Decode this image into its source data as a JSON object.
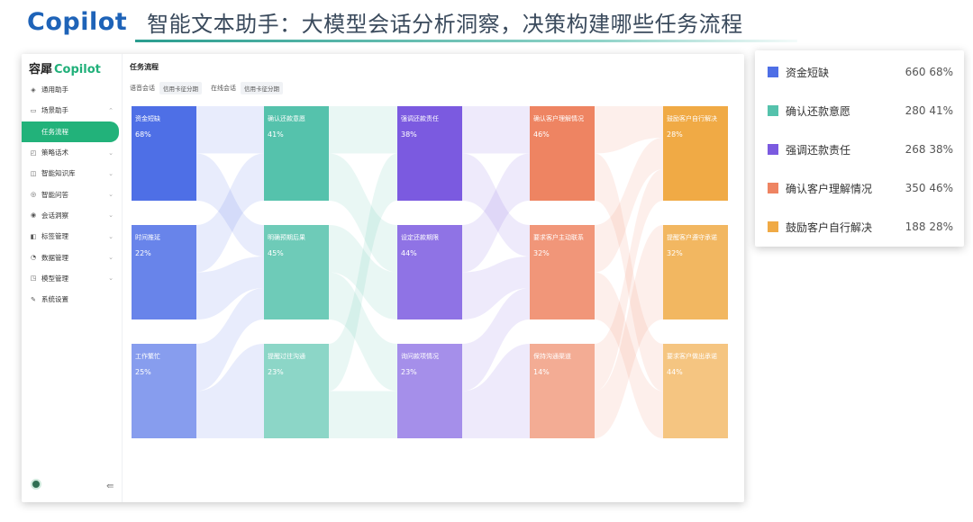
{
  "slide": {
    "brand": "Copilot",
    "headline": "智能文本助手：大模型会话分析洞察，决策构建哪些任务流程"
  },
  "app": {
    "logo_cn": "容犀",
    "logo_en": "Copilot",
    "page_title": "任务流程",
    "filters": {
      "voice_label": "语音会话",
      "voice_tag": "信用卡征分期",
      "online_label": "在线会话",
      "online_tag": "信用卡征分期"
    },
    "sidebar": {
      "items": [
        {
          "label": "通用助手",
          "icon": "layers-icon",
          "icon_char": "◈",
          "expandable": false
        },
        {
          "label": "场景助手",
          "icon": "monitor-icon",
          "icon_char": "▭",
          "expandable": true,
          "expanded": true
        },
        {
          "label": "任务流程",
          "icon": "",
          "icon_char": "",
          "sub": true,
          "active": true
        },
        {
          "label": "策略话术",
          "icon": "chat-icon",
          "icon_char": "◰",
          "expandable": true
        },
        {
          "label": "智能知识库",
          "icon": "book-icon",
          "icon_char": "◫",
          "expandable": true
        },
        {
          "label": "智能问答",
          "icon": "qa-icon",
          "icon_char": "◎",
          "expandable": true
        },
        {
          "label": "会话洞察",
          "icon": "insight-icon",
          "icon_char": "◉",
          "expandable": true
        },
        {
          "label": "标签管理",
          "icon": "tag-icon",
          "icon_char": "◧",
          "expandable": true
        },
        {
          "label": "数据管理",
          "icon": "data-icon",
          "icon_char": "◔",
          "expandable": true
        },
        {
          "label": "模型管理",
          "icon": "model-icon",
          "icon_char": "◳",
          "expandable": true
        },
        {
          "label": "系统设置",
          "icon": "wrench-icon",
          "icon_char": "✎",
          "expandable": false
        }
      ]
    }
  },
  "chart_data": {
    "type": "sankey",
    "columns": [
      {
        "color": "#4e6fe6",
        "nodes": [
          {
            "label": "资金短缺",
            "pct": "68%"
          },
          {
            "label": "时间推延",
            "pct": "22%"
          },
          {
            "label": "工作繁忙",
            "pct": "25%"
          }
        ]
      },
      {
        "color": "#55c2ac",
        "nodes": [
          {
            "label": "确认还款意愿",
            "pct": "41%"
          },
          {
            "label": "明确预期后果",
            "pct": "45%"
          },
          {
            "label": "提醒过往沟通",
            "pct": "23%"
          }
        ]
      },
      {
        "color": "#7b5ae0",
        "nodes": [
          {
            "label": "强调还款责任",
            "pct": "38%"
          },
          {
            "label": "设定还款期限",
            "pct": "44%"
          },
          {
            "label": "询问款项情况",
            "pct": "23%"
          }
        ]
      },
      {
        "color": "#ee8462",
        "nodes": [
          {
            "label": "确认客户理解情况",
            "pct": "46%"
          },
          {
            "label": "要求客户主动联系",
            "pct": "32%"
          },
          {
            "label": "保持沟通渠道",
            "pct": "14%"
          }
        ]
      },
      {
        "color": "#f0aa45",
        "nodes": [
          {
            "label": "鼓励客户自行解决",
            "pct": "28%"
          },
          {
            "label": "提醒客户遵守承诺",
            "pct": "32%"
          },
          {
            "label": "要求客户做出承诺",
            "pct": "44%"
          }
        ]
      }
    ],
    "links": [
      [
        [
          0,
          0
        ],
        [
          0,
          1
        ],
        [
          1,
          0
        ],
        [
          1,
          1
        ],
        [
          2,
          1
        ],
        [
          2,
          2
        ]
      ],
      [
        [
          0,
          0
        ],
        [
          0,
          1
        ],
        [
          1,
          1
        ],
        [
          1,
          2
        ],
        [
          2,
          0
        ],
        [
          2,
          2
        ]
      ],
      [
        [
          0,
          0
        ],
        [
          0,
          1
        ],
        [
          1,
          0
        ],
        [
          1,
          1
        ],
        [
          2,
          1
        ],
        [
          2,
          2
        ]
      ],
      [
        [
          0,
          0
        ],
        [
          0,
          2
        ],
        [
          1,
          0
        ],
        [
          1,
          2
        ],
        [
          2,
          0
        ],
        [
          2,
          1
        ]
      ]
    ]
  },
  "legend": [
    {
      "name": "资金短缺",
      "value": "660",
      "pct": "68%",
      "color": "#4e6fe6"
    },
    {
      "name": "确认还款意愿",
      "value": "280",
      "pct": "41%",
      "color": "#55c2ac"
    },
    {
      "name": "强调还款责任",
      "value": "268",
      "pct": "38%",
      "color": "#7b5ae0"
    },
    {
      "name": "确认客户理解情况",
      "value": "350",
      "pct": "46%",
      "color": "#ee8462"
    },
    {
      "name": "鼓励客户自行解决",
      "value": "188",
      "pct": "28%",
      "color": "#f0aa45"
    }
  ]
}
